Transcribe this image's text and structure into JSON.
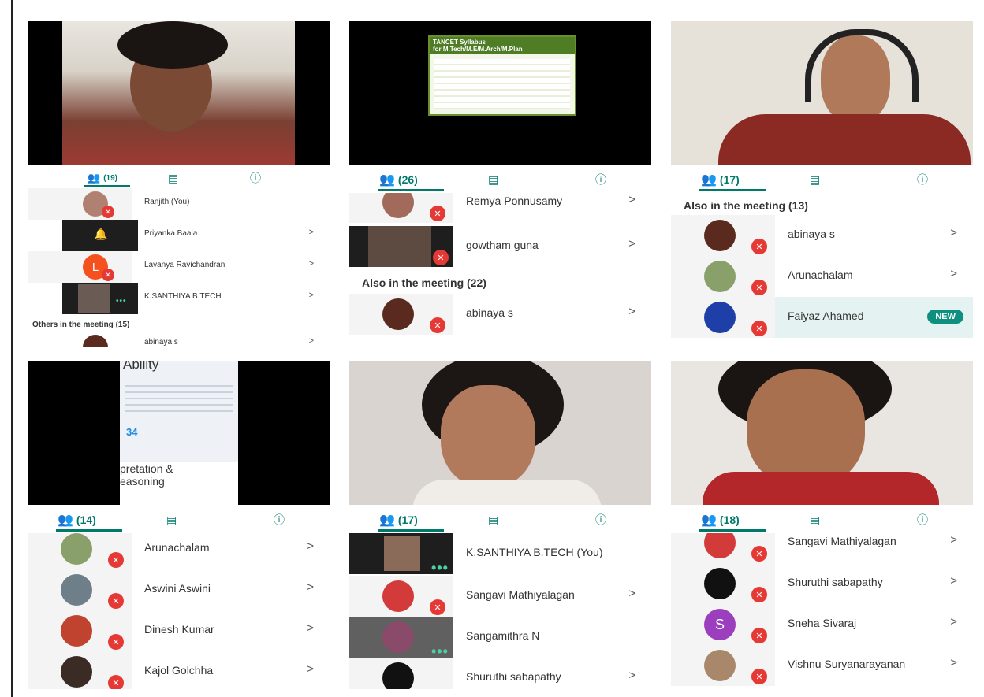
{
  "panels": [
    {
      "count": "(19)",
      "participants": [
        {
          "name": "Ranjith (You)"
        },
        {
          "name": "Priyanka Baala"
        },
        {
          "name": "Lavanya Ravichandran",
          "initial": "L"
        },
        {
          "name": "K.SANTHIYA B.TECH"
        }
      ],
      "section": "Others in the meeting (15)",
      "after": [
        {
          "name": "abinaya s"
        }
      ]
    },
    {
      "count": "(26)",
      "slide": {
        "title": "TANCET Syllabus\nfor M.Tech/M.E/M.Arch/M.Plan"
      },
      "participants": [
        {
          "name": "Remya Ponnusamy"
        },
        {
          "name": "gowtham guna"
        }
      ],
      "section": "Also in the meeting (22)",
      "after": [
        {
          "name": "abinaya s"
        }
      ]
    },
    {
      "count": "(17)",
      "section": "Also in the meeting (13)",
      "participants": [
        {
          "name": "abinaya s"
        },
        {
          "name": "Arunachalam"
        },
        {
          "name": "Faiyaz Ahamed",
          "badge": "NEW"
        }
      ]
    },
    {
      "count": "(14)",
      "slide": {
        "heading": "Ability",
        "percent": "34",
        "footer": "pretation &\neasoning"
      },
      "participants": [
        {
          "name": "Arunachalam"
        },
        {
          "name": "Aswini Aswini"
        },
        {
          "name": "Dinesh Kumar"
        },
        {
          "name": "Kajol Golchha"
        }
      ]
    },
    {
      "count": "(17)",
      "participants": [
        {
          "name": "K.SANTHIYA B.TECH (You)"
        },
        {
          "name": "Sangavi Mathiyalagan"
        },
        {
          "name": "Sangamithra N"
        },
        {
          "name": "Shuruthi sabapathy"
        }
      ]
    },
    {
      "count": "(18)",
      "participants": [
        {
          "name": "Sangavi Mathiyalagan"
        },
        {
          "name": "Shuruthi sabapathy"
        },
        {
          "name": "Sneha Sivaraj",
          "initial": "S"
        },
        {
          "name": "Vishnu Suryanarayanan"
        }
      ]
    }
  ],
  "icons": {
    "chevron": ">",
    "mic_off": "✕",
    "more": "•••"
  },
  "colors": {
    "accent": "#00796b",
    "mic_off": "#e53935",
    "new_badge": "#0f8f7f"
  }
}
